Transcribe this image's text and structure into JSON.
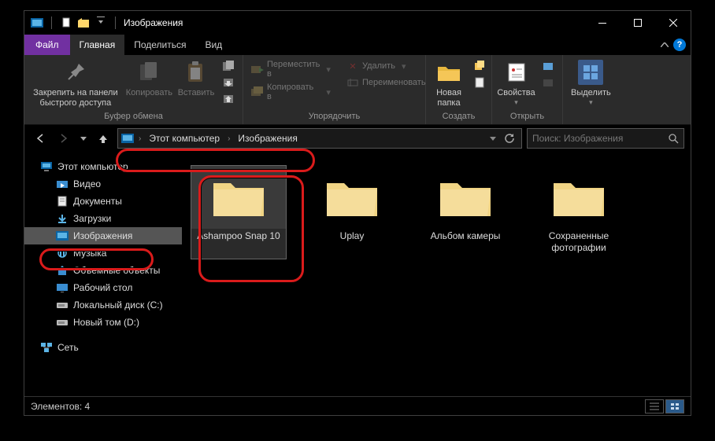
{
  "window": {
    "title": "Изображения"
  },
  "tabs": {
    "file": "Файл",
    "items": [
      "Главная",
      "Поделиться",
      "Вид"
    ],
    "active_index": 0
  },
  "ribbon": {
    "clipboard": {
      "pin": "Закрепить на панели\nбыстрого доступа",
      "copy": "Копировать",
      "paste": "Вставить",
      "group_label": "Буфер обмена"
    },
    "organize": {
      "move_to": "Переместить в",
      "copy_to": "Копировать в",
      "delete": "Удалить",
      "rename": "Переименовать",
      "group_label": "Упорядочить"
    },
    "new_group": {
      "new_folder": "Новая\nпапка",
      "group_label": "Создать"
    },
    "open_group": {
      "properties": "Свойства",
      "group_label": "Открыть"
    },
    "select_group": {
      "select": "Выделить"
    }
  },
  "breadcrumb": {
    "parts": [
      "Этот компьютер",
      "Изображения"
    ]
  },
  "search": {
    "placeholder": "Поиск: Изображения"
  },
  "tree": {
    "root": "Этот компьютер",
    "children": [
      "Видео",
      "Документы",
      "Загрузки",
      "Изображения",
      "Музыка",
      "Объемные объекты",
      "Рабочий стол",
      "Локальный диск (C:)",
      "Новый том (D:)"
    ],
    "selected_index": 3,
    "network": "Сеть"
  },
  "items": {
    "list": [
      {
        "name": "Ashampoo Snap 10",
        "selected": true
      },
      {
        "name": "Uplay",
        "selected": false
      },
      {
        "name": "Альбом камеры",
        "selected": false
      },
      {
        "name": "Сохраненные фотографии",
        "selected": false
      }
    ]
  },
  "status": {
    "text": "Элементов: 4"
  }
}
